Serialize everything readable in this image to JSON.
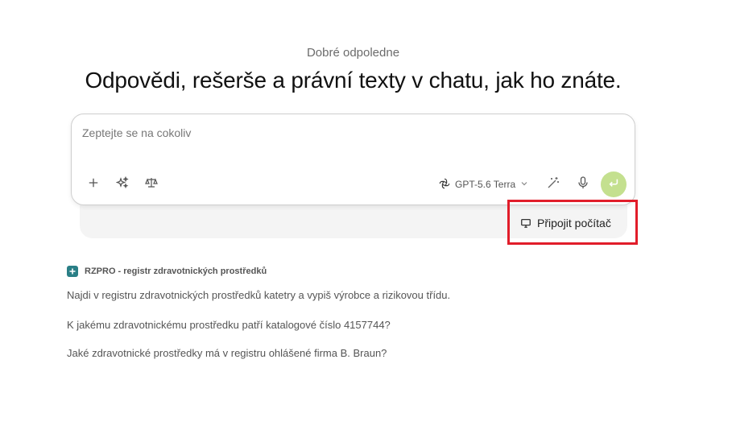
{
  "greeting": "Dobré odpoledne",
  "headline": "Odpovědi, rešerše a právní texty v chatu, jak ho znáte.",
  "composer": {
    "placeholder": "Zeptejte se na cokoliv",
    "tools": [
      "plus-icon",
      "sparkles-icon",
      "scales-icon"
    ],
    "model_label": "GPT-5.6 Terra",
    "right_tools": [
      "magic-wand-icon",
      "microphone-icon"
    ],
    "send_icon": "enter-icon",
    "send_color": "#c4e08f"
  },
  "connect": {
    "label": "Připojit počítač",
    "icon": "monitor-icon"
  },
  "highlight_color": "#e11d2a",
  "source": {
    "label": "RZPRO - registr zdravotnických prostředků",
    "badge_color": "#2a7f86"
  },
  "suggestions": [
    "Najdi v registru zdravotnických prostředků katetry a vypiš výrobce a rizikovou třídu.",
    "K jakému zdravotnickému prostředku patří katalogové číslo 4157744?",
    "Jaké zdravotnické prostředky má v registru ohlášené firma B. Braun?"
  ]
}
